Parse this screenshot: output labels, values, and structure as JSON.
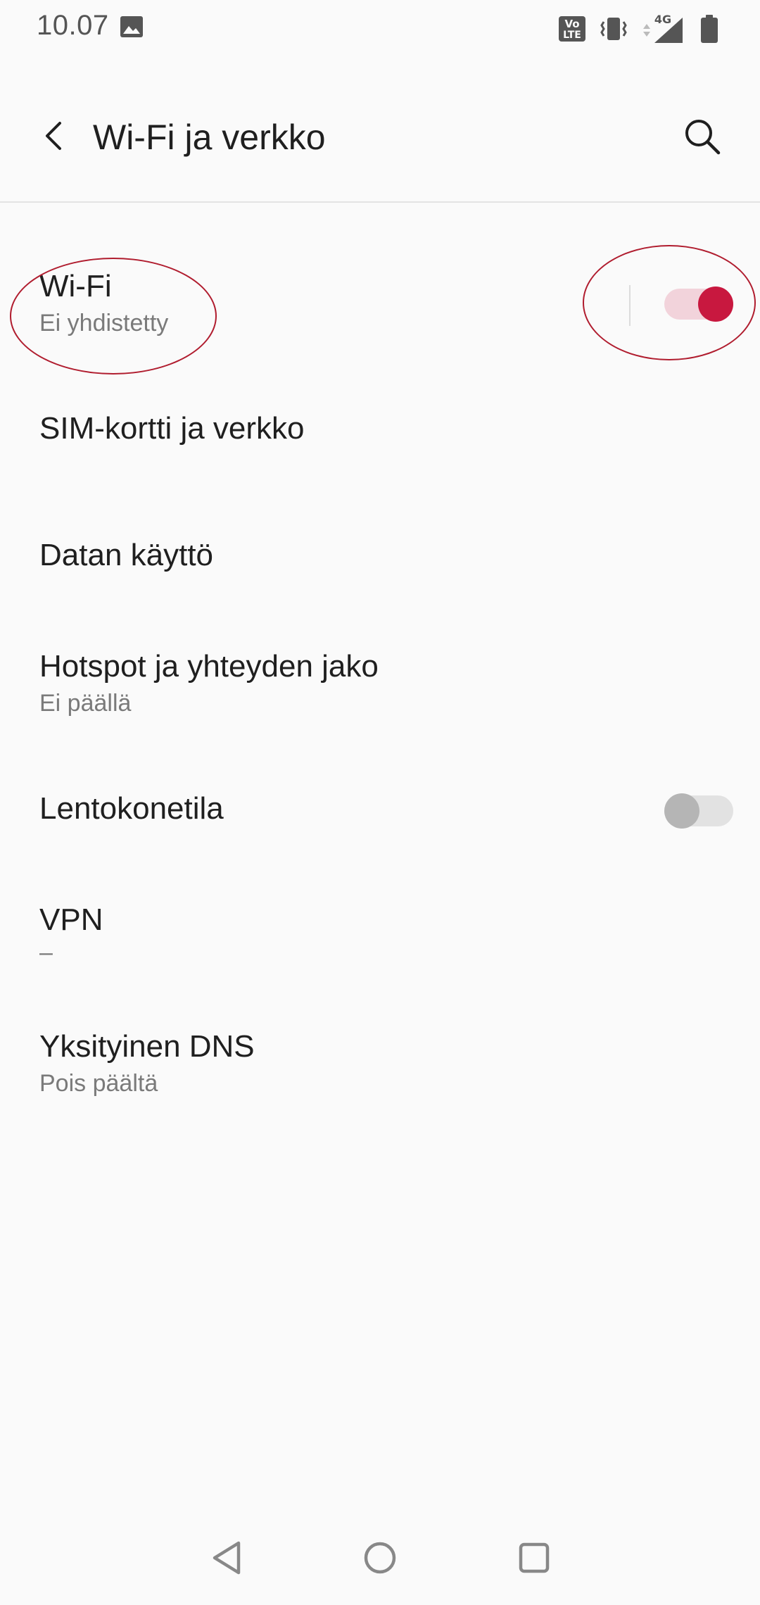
{
  "status_bar": {
    "time": "10.07",
    "icons": [
      "gallery-icon",
      "volte-icon",
      "vibrate-icon",
      "data-arrows-icon",
      "signal-4g-icon",
      "battery-icon"
    ],
    "network_label": "4G",
    "volte_label_top": "Vo",
    "volte_label_bottom": "LTE"
  },
  "app_bar": {
    "title": "Wi-Fi ja verkko",
    "back_icon": "back-arrow-icon",
    "search_icon": "search-icon"
  },
  "settings": {
    "wifi": {
      "title": "Wi-Fi",
      "summary": "Ei yhdistetty",
      "toggle_on": true
    },
    "sim": {
      "title": "SIM-kortti ja verkko"
    },
    "data_usage": {
      "title": "Datan käyttö"
    },
    "hotspot": {
      "title": "Hotspot ja yhteyden jako",
      "summary": "Ei päällä"
    },
    "airplane": {
      "title": "Lentokonetila",
      "toggle_on": false
    },
    "vpn": {
      "title": "VPN",
      "summary": "–"
    },
    "private_dns": {
      "title": "Yksityinen DNS",
      "summary": "Pois päältä"
    }
  },
  "nav_bar": {
    "icons": [
      "nav-back-icon",
      "nav-home-icon",
      "nav-recents-icon"
    ]
  },
  "colors": {
    "background": "#fafafa",
    "accent": "#c8183f",
    "accent_track": "#f2d3db",
    "annotation": "#b01c2e",
    "text_primary": "#1f1f1f",
    "text_secondary": "#7a7a7a"
  }
}
